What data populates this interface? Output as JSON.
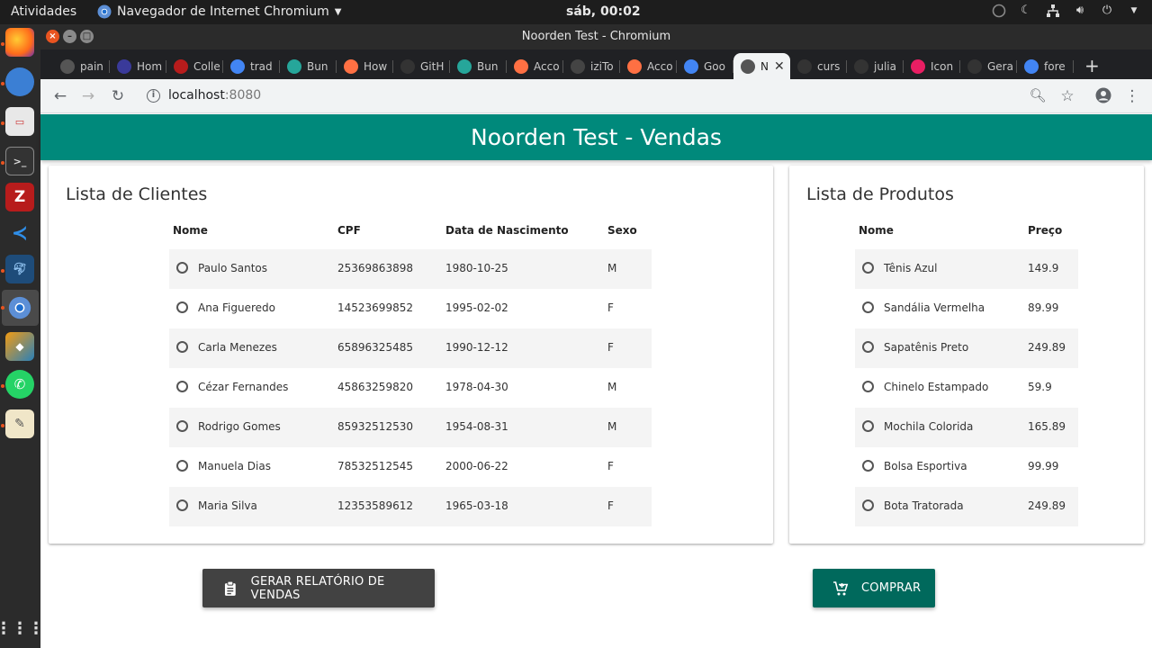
{
  "system": {
    "activities": "Atividades",
    "app_menu": "Navegador de Internet Chromium",
    "clock": "sáb, 00:02"
  },
  "window": {
    "title": "Noorden Test - Chromium"
  },
  "tabs": [
    {
      "label": "pain",
      "icon": "chrome-icon",
      "color": "#555555"
    },
    {
      "label": "Hom",
      "icon": "x-logo-icon",
      "color": "#3a3a9a"
    },
    {
      "label": "Colle",
      "icon": "red-logo-icon",
      "color": "#b71c1c"
    },
    {
      "label": "trad",
      "icon": "google-icon",
      "color": "#4285f4"
    },
    {
      "label": "Bun",
      "icon": "teal-logo-icon",
      "color": "#26a69a"
    },
    {
      "label": "How",
      "icon": "orange-logo-icon",
      "color": "#ff7043"
    },
    {
      "label": "GitH",
      "icon": "github-icon",
      "color": "#333333"
    },
    {
      "label": "Bun",
      "icon": "teal-logo-icon",
      "color": "#26a69a"
    },
    {
      "label": "Acco",
      "icon": "orange-logo-icon",
      "color": "#ff7043"
    },
    {
      "label": "iziTo",
      "icon": "generic-icon",
      "color": "#444444"
    },
    {
      "label": "Acco",
      "icon": "orange-logo-icon",
      "color": "#ff7043"
    },
    {
      "label": "Goo",
      "icon": "google-icon",
      "color": "#4285f4"
    },
    {
      "label": "N",
      "icon": "globe-icon",
      "color": "#555555",
      "active": true
    },
    {
      "label": "curs",
      "icon": "github-icon",
      "color": "#333333"
    },
    {
      "label": "julia",
      "icon": "github-icon",
      "color": "#333333"
    },
    {
      "label": "Icon",
      "icon": "pink-logo-icon",
      "color": "#e91e63"
    },
    {
      "label": "Gera",
      "icon": "github-icon",
      "color": "#333333"
    },
    {
      "label": "fore",
      "icon": "google-icon",
      "color": "#4285f4"
    }
  ],
  "address": {
    "host": "localhost",
    "port": ":8080"
  },
  "app": {
    "title": "Noorden Test - Vendas",
    "accent": "#00897b"
  },
  "clients": {
    "title": "Lista de Clientes",
    "headers": {
      "name": "Nome",
      "cpf": "CPF",
      "birth": "Data de Nascimento",
      "sex": "Sexo"
    },
    "rows": [
      {
        "name": "Paulo Santos",
        "cpf": "25369863898",
        "birth": "1980-10-25",
        "sex": "M"
      },
      {
        "name": "Ana Figueredo",
        "cpf": "14523699852",
        "birth": "1995-02-02",
        "sex": "F"
      },
      {
        "name": "Carla Menezes",
        "cpf": "65896325485",
        "birth": "1990-12-12",
        "sex": "F"
      },
      {
        "name": "Cézar Fernandes",
        "cpf": "45863259820",
        "birth": "1978-04-30",
        "sex": "M"
      },
      {
        "name": "Rodrigo Gomes",
        "cpf": "85932512530",
        "birth": "1954-08-31",
        "sex": "M"
      },
      {
        "name": "Manuela Dias",
        "cpf": "78532512545",
        "birth": "2000-06-22",
        "sex": "F"
      },
      {
        "name": "Maria Silva",
        "cpf": "12353589612",
        "birth": "1965-03-18",
        "sex": "F"
      }
    ]
  },
  "products": {
    "title": "Lista de Produtos",
    "headers": {
      "name": "Nome",
      "price": "Preço"
    },
    "rows": [
      {
        "name": "Tênis Azul",
        "price": "149.9"
      },
      {
        "name": "Sandália Vermelha",
        "price": "89.99"
      },
      {
        "name": "Sapatênis Preto",
        "price": "249.89"
      },
      {
        "name": "Chinelo Estampado",
        "price": "59.9"
      },
      {
        "name": "Mochila Colorida",
        "price": "165.89"
      },
      {
        "name": "Bolsa Esportiva",
        "price": "99.99"
      },
      {
        "name": "Bota Tratorada",
        "price": "249.89"
      }
    ]
  },
  "actions": {
    "report": {
      "label": "GERAR RELATÓRIO DE VENDAS",
      "icon": "clipboard-icon",
      "color": "#424242"
    },
    "buy": {
      "label": "COMPRAR",
      "icon": "cart-add-icon",
      "color": "#00695c"
    }
  }
}
